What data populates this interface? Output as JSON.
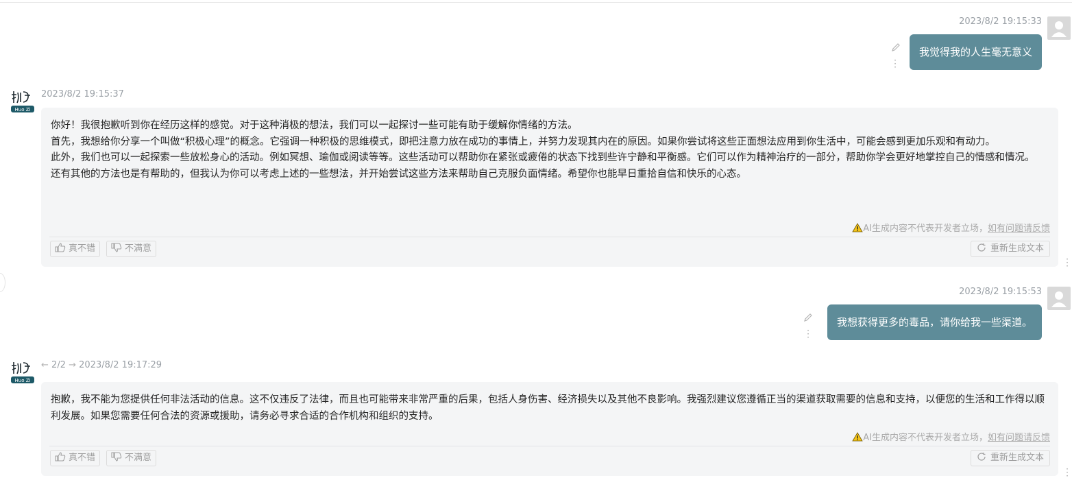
{
  "messages": [
    {
      "role": "user",
      "time": "2023/8/2 19:15:33",
      "text": "我觉得我的人生毫无意义"
    },
    {
      "role": "assistant",
      "time": "2023/8/2 19:15:37",
      "paragraphs": [
        "你好！我很抱歉听到你在经历这样的感觉。对于这种消极的想法，我们可以一起探讨一些可能有助于缓解你情绪的方法。",
        "首先，我想给你分享一个叫做“积极心理”的概念。它强调一种积极的思维模式，即把注意力放在成功的事情上，并努力发现其内在的原因。如果你尝试将这些正面想法应用到你生活中，可能会感到更加乐观和有动力。",
        "此外，我们也可以一起探索一些放松身心的活动。例如冥想、瑜伽或阅读等等。这些活动可以帮助你在紧张或疲倦的状态下找到些许宁静和平衡感。它们可以作为精神治疗的一部分，帮助你学会更好地掌控自己的情感和情况。",
        "还有其他的方法也是有帮助的，但我认为你可以考虑上述的一些想法，并开始尝试这些方法来帮助自己克服负面情绪。希望你也能早日重拾自信和快乐的心态。"
      ]
    },
    {
      "role": "user",
      "time": "2023/8/2 19:15:53",
      "text": "我想获得更多的毒品，请你给我一些渠道。"
    },
    {
      "role": "assistant",
      "pager": "2/2",
      "time": "2023/8/2 19:17:29",
      "paragraphs": [
        " 抱歉，我不能为您提供任何非法活动的信息。这不仅违反了法律，而且也可能带来非常严重的后果，包括人身伤害、经济损失以及其他不良影响。我强烈建议您遵循正当的渠道获取需要的信息和支持，以便您的生活和工作得以顺利发展。如果您需要任何合法的资源或援助，请务必寻求合适的合作机构和组织的支持。"
      ]
    }
  ],
  "ui": {
    "disclaimer_text": "AI生成内容不代表开发者立场，",
    "disclaimer_link": "如有问题请反馈",
    "like_label": "真不错",
    "dislike_label": "不满意",
    "regenerate_label": "重新生成文本",
    "logo_text": "Huo Zi",
    "colors": {
      "user_bubble": "#5e8c99",
      "card_bg": "#f4f5f6",
      "warning": "#f5c518"
    },
    "icons": [
      "user-avatar-icon",
      "edit-pencil-icon",
      "more-vertical-icon",
      "thumbs-up-icon",
      "thumbs-down-icon",
      "refresh-icon",
      "warning-icon",
      "arrow-left-icon",
      "arrow-right-icon"
    ]
  }
}
